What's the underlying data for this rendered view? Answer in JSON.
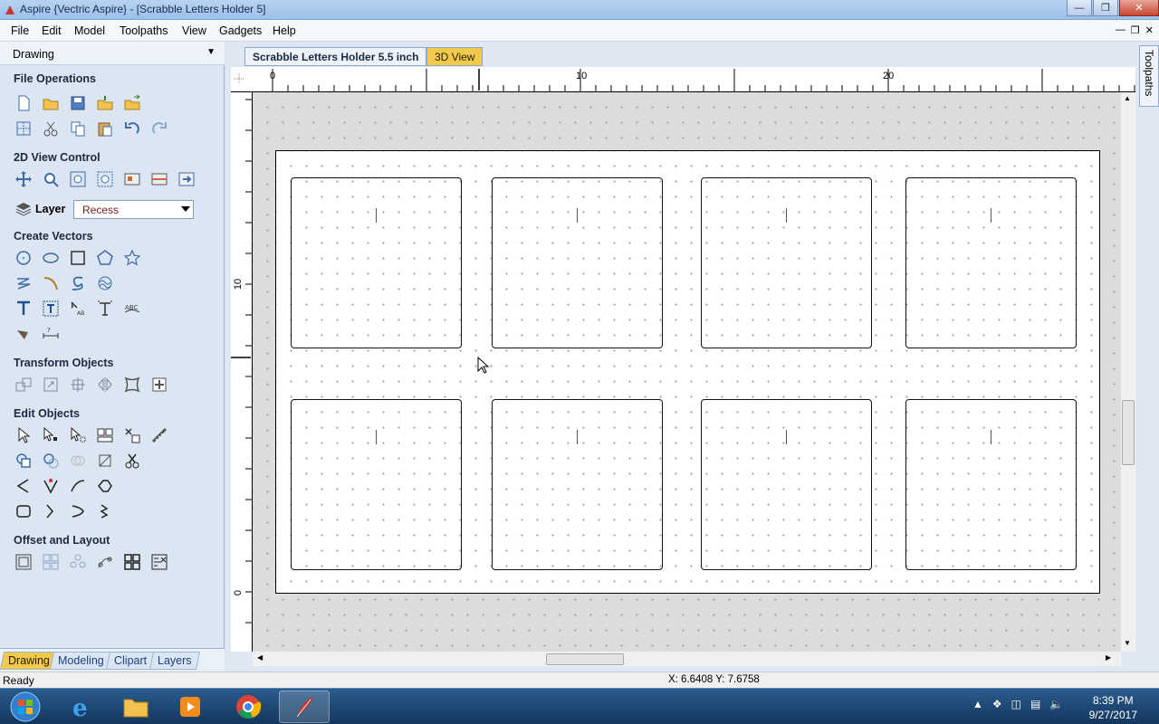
{
  "window": {
    "title": "Aspire {Vectric Aspire} - [Scrabble Letters Holder 5]"
  },
  "menu": [
    "File",
    "Edit",
    "Model",
    "Toolpaths",
    "View",
    "Gadgets",
    "Help"
  ],
  "panel": {
    "title": "Drawing",
    "sections": {
      "file_ops": "File Operations",
      "view_ctrl": "2D View Control",
      "create": "Create Vectors",
      "transform": "Transform Objects",
      "edit": "Edit Objects",
      "offset": "Offset and Layout"
    },
    "layer_label": "Layer",
    "layer_value": "Recess",
    "tabs": [
      "Drawing",
      "Modeling",
      "Clipart",
      "Layers"
    ]
  },
  "document": {
    "tabs": [
      "Scrabble Letters Holder 5.5 inch",
      "3D View"
    ],
    "ruler_top": [
      "0",
      "10",
      "20"
    ],
    "ruler_left": [
      "10",
      "0"
    ],
    "right_tab": "Toolpaths"
  },
  "status": {
    "text": "Ready",
    "coords": "X: 6.6408 Y: 7.6758"
  },
  "taskbar": {
    "time": "8:39 PM",
    "date": "9/27/2017"
  },
  "colors": {
    "active_tab": "#f3c94d",
    "taskbar": "#14375e",
    "panel": "#dce6f3"
  }
}
